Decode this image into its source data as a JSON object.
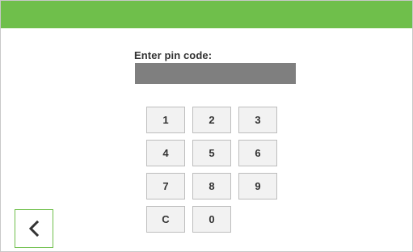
{
  "header": {
    "accent_color": "#6fbf4b"
  },
  "pin": {
    "label": "Enter pin code:",
    "value": ""
  },
  "keypad": {
    "keys": [
      "1",
      "2",
      "3",
      "4",
      "5",
      "6",
      "7",
      "8",
      "9",
      "C",
      "0"
    ]
  },
  "navigation": {
    "back_icon": "chevron-left-icon"
  }
}
